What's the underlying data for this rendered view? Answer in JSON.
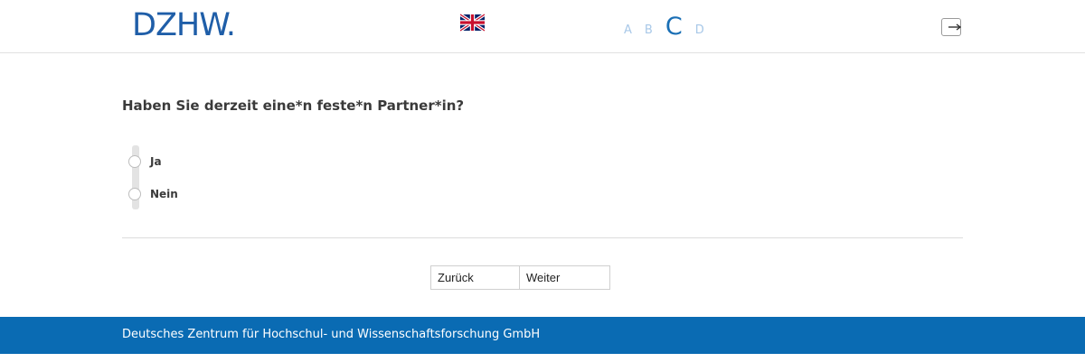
{
  "header": {
    "logo_text": "DZHW.",
    "language_flag": "uk-flag-icon",
    "modules": [
      {
        "label": "A",
        "active": false
      },
      {
        "label": "B",
        "active": false
      },
      {
        "label": "C",
        "active": true
      },
      {
        "label": "D",
        "active": false
      }
    ],
    "exit_icon": "exit-icon"
  },
  "question": {
    "text": "Haben Sie derzeit eine*n feste*n Partner*in?",
    "options": [
      {
        "label": "Ja",
        "selected": false
      },
      {
        "label": "Nein",
        "selected": false
      }
    ]
  },
  "navigation": {
    "back_label": "Zurück",
    "next_label": "Weiter"
  },
  "footer": {
    "text": "Deutsches Zentrum für Hochschul- und Wissenschaftsforschung GmbH"
  },
  "colors": {
    "brand_blue": "#1f5ea8",
    "footer_blue": "#0a6bb3",
    "module_inactive": "#a8c8e8"
  }
}
